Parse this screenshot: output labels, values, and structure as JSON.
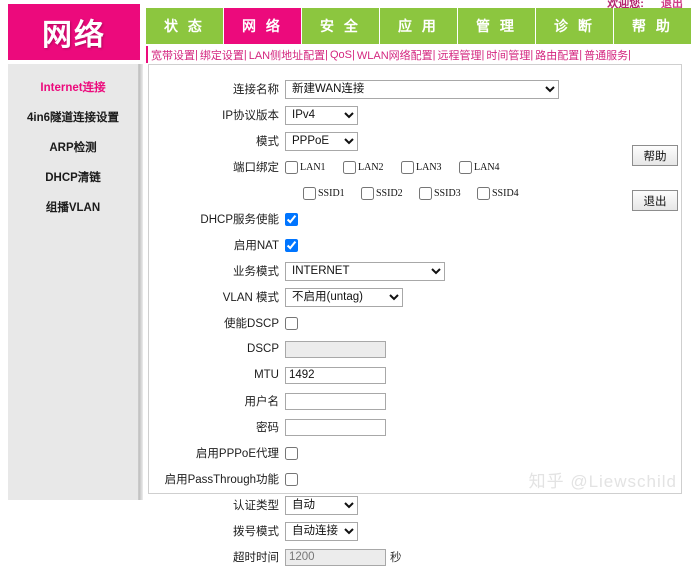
{
  "topbar": {
    "welcome_label": "欢迎您:",
    "logout_label": "退出"
  },
  "header": {
    "logo_text": "网络",
    "tabs": [
      {
        "label": "状 态",
        "active": false
      },
      {
        "label": "网 络",
        "active": true
      },
      {
        "label": "安 全",
        "active": false
      },
      {
        "label": "应 用",
        "active": false
      },
      {
        "label": "管 理",
        "active": false
      },
      {
        "label": "诊 断",
        "active": false
      },
      {
        "label": "帮 助",
        "active": false
      }
    ],
    "subnav": [
      "宽带设置",
      "绑定设置",
      "LAN侧地址配置",
      "QoS",
      "WLAN网络配置",
      "远程管理",
      "时间管理",
      "路由配置",
      "普通服务"
    ],
    "subnav_separator": "|"
  },
  "sidebar": {
    "items": [
      {
        "label": "Internet连接",
        "active": true
      },
      {
        "label": "4in6隧道连接设置",
        "active": false
      },
      {
        "label": "ARP检测",
        "active": false
      },
      {
        "label": "DHCP清链",
        "active": false
      },
      {
        "label": "组播VLAN",
        "active": false
      }
    ]
  },
  "form": {
    "connection_name": {
      "label": "连接名称",
      "value": "新建WAN连接"
    },
    "ip_version": {
      "label": "IP协议版本",
      "value": "IPv4"
    },
    "mode": {
      "label": "模式",
      "value": "PPPoE"
    },
    "port_binding": {
      "label": "端口绑定",
      "lan": [
        {
          "label": "LAN1",
          "checked": false
        },
        {
          "label": "LAN2",
          "checked": false
        },
        {
          "label": "LAN3",
          "checked": false
        },
        {
          "label": "LAN4",
          "checked": false
        }
      ],
      "ssid": [
        {
          "label": "SSID1",
          "checked": false
        },
        {
          "label": "SSID2",
          "checked": false
        },
        {
          "label": "SSID3",
          "checked": false
        },
        {
          "label": "SSID4",
          "checked": false
        }
      ]
    },
    "dhcp_service": {
      "label": "DHCP服务使能",
      "checked": true
    },
    "enable_nat": {
      "label": "启用NAT",
      "checked": true
    },
    "service_mode": {
      "label": "业务模式",
      "value": "INTERNET"
    },
    "vlan_mode": {
      "label": "VLAN 模式",
      "value": "不启用(untag)"
    },
    "enable_dscp": {
      "label": "使能DSCP",
      "checked": false
    },
    "dscp": {
      "label": "DSCP",
      "value": "",
      "placeholder": ""
    },
    "mtu": {
      "label": "MTU",
      "value": "1492"
    },
    "username": {
      "label": "用户名",
      "value": ""
    },
    "password": {
      "label": "密码",
      "value": ""
    },
    "enable_pppoe_proxy": {
      "label": "启用PPPoE代理",
      "checked": false
    },
    "enable_passthrough": {
      "label": "启用PassThrough功能",
      "checked": false
    },
    "auth_type": {
      "label": "认证类型",
      "value": "自动"
    },
    "dial_mode": {
      "label": "拨号模式",
      "value": "自动连接"
    },
    "timeout": {
      "label": "超时时间",
      "value": "1200",
      "unit": "秒"
    }
  },
  "side_buttons": {
    "help": "帮助",
    "exit": "退出"
  },
  "watermark": "知乎 @Liewschild",
  "colors": {
    "brand_pink": "#ec0a7c",
    "nav_green": "#8cc63f",
    "sidebar_bg": "#e8e8e8",
    "link_pink": "#d4267f"
  }
}
